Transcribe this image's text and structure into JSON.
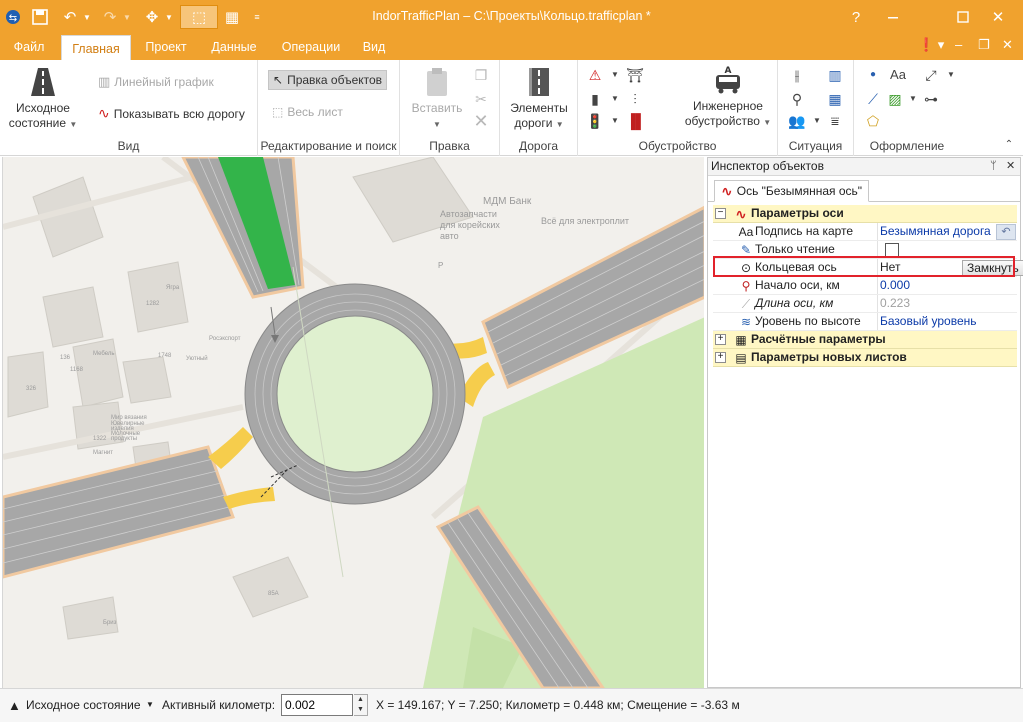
{
  "window": {
    "title": "IndorTrafficPlan – C:\\Проекты\\Кольцо.trafficplan *",
    "help": "?",
    "minimize": "—",
    "maximize": "☐",
    "close": "✕"
  },
  "menu": {
    "tabs": [
      "Файл",
      "Главная",
      "Проект",
      "Данные",
      "Операции",
      "Вид"
    ],
    "active": "Главная"
  },
  "ribbon": {
    "view": {
      "label": "Вид",
      "initial_state": "Исходное состояние",
      "initial_state_l1": "Исходное",
      "initial_state_l2": "состояние",
      "linear_graph": "Линейный график",
      "show_road": "Показывать всю дорогу"
    },
    "edit": {
      "label": "Редактирование и поиск",
      "edit_objects": "Правка объектов",
      "whole_sheet": "Весь лист"
    },
    "clipboard": {
      "label": "Правка",
      "paste": "Вставить"
    },
    "road": {
      "label": "Дорога",
      "elements_l1": "Элементы",
      "elements_l2": "дороги"
    },
    "equipment": {
      "label": "Обустройство",
      "eng_l1": "Инженерное",
      "eng_l2": "обустройство"
    },
    "situation": {
      "label": "Ситуация"
    },
    "design": {
      "label": "Оформление",
      "text_icon": "Aa"
    }
  },
  "map": {
    "labels": {
      "bank": "МДМ Банк",
      "parts_1": "Автозапчасти",
      "parts_2": "для корейских",
      "parts_3": "авто",
      "stoves": "Всё для электроплит",
      "parking": "P",
      "b1": "1282",
      "b2": "Ягра",
      "b3": "Росэкспорт",
      "b4": "1748",
      "b5": "Уютный",
      "b6": "136",
      "b7": "Мебель",
      "b8": "1168",
      "b9": "326",
      "b10": "Мир вязания",
      "b11": "Ювелирные",
      "b12": "изделия",
      "b13": "Молочные",
      "b14": "продукты",
      "b15": "1322",
      "b16": "Магнит",
      "b17": "85А",
      "b18": "Бриз"
    }
  },
  "inspector": {
    "title": "Инспектор объектов",
    "pin": "ᛘ",
    "close": "✕",
    "tab": "Ось \"Безымянная ось\"",
    "sections": {
      "axis_params": "Параметры оси",
      "calc_params": "Расчётные параметры",
      "new_sheet_params": "Параметры новых листов"
    },
    "rows": {
      "map_label": {
        "name": "Подпись на карте",
        "value": "Безымянная дорога"
      },
      "read_only": {
        "name": "Только чтение"
      },
      "ring_axis": {
        "name": "Кольцевая ось",
        "value": "Нет",
        "button": "Замкнуть"
      },
      "axis_start": {
        "name": "Начало оси, км",
        "value": "0.000"
      },
      "axis_length": {
        "name": "Длина оси, км",
        "value": "0.223"
      },
      "height_level": {
        "name": "Уровень по высоте",
        "value": "Базовый уровень"
      }
    }
  },
  "status": {
    "state": "Исходное состояние",
    "active_km_label": "Активный километр:",
    "active_km_value": "0.002",
    "coords": "X = 149.167; Y = 7.250; Километр = 0.448 км; Смещение = -3.63 м"
  },
  "colors": {
    "accent": "#f0a22e",
    "map_bg": "#f2f0ec",
    "road_gray": "#a7a7a7",
    "ring_inner": "#dff0cf",
    "park_green": "#cfe8b6",
    "lane_green": "#33b44a",
    "connector_yellow": "#f6cd4c",
    "highlight_red": "#e2222b"
  }
}
